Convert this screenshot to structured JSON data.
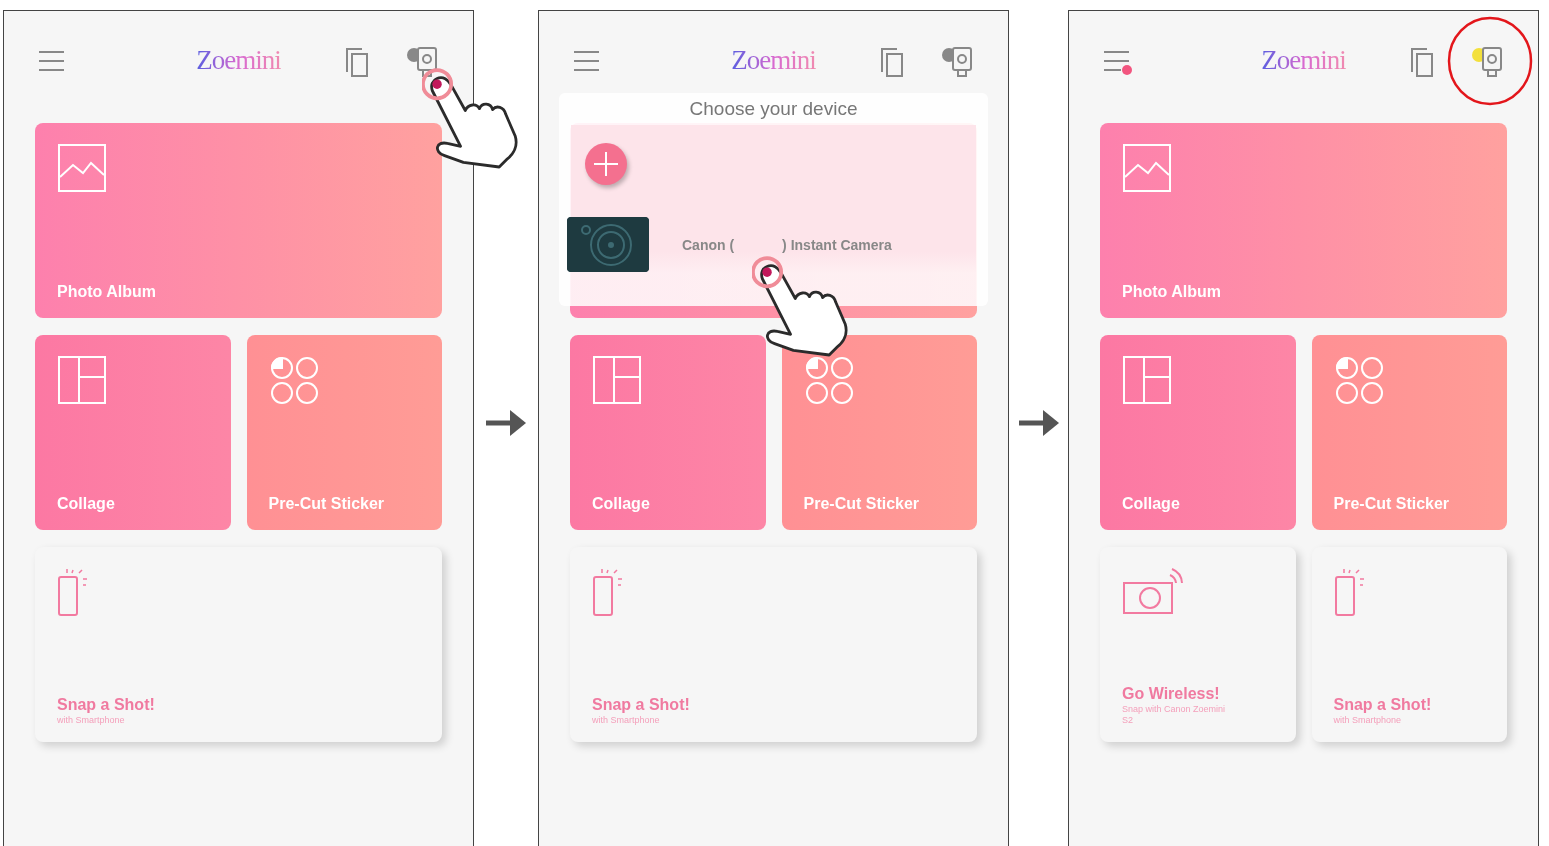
{
  "panels": [
    {
      "header": {
        "logo": "Zoemini",
        "menu_badge": false,
        "device_connected": false
      },
      "rows": [
        [
          {
            "kind": "photo",
            "title": "Photo Album"
          }
        ],
        [
          {
            "kind": "collage",
            "title": "Collage"
          },
          {
            "kind": "sticker",
            "title": "Pre-Cut Sticker"
          }
        ],
        [
          {
            "kind": "phone",
            "title": "Snap a Shot!",
            "subtitle": "with Smartphone"
          }
        ]
      ],
      "overlay": {
        "kind": "tap_device_icon"
      }
    },
    {
      "header": {
        "logo": "Zoemini",
        "menu_badge": false,
        "device_connected": false
      },
      "rows": [
        [
          {
            "kind": "photo"
          }
        ],
        [
          {
            "kind": "collage",
            "title": "Collage"
          },
          {
            "kind": "sticker",
            "title": "Pre-Cut Sticker"
          }
        ],
        [
          {
            "kind": "phone",
            "title": "Snap a Shot!",
            "subtitle": "with Smartphone"
          }
        ]
      ],
      "overlay": {
        "kind": "device_picker",
        "title": "Choose your device",
        "device_name_parts": [
          "Canon (",
          ") Instant Camera"
        ]
      }
    },
    {
      "header": {
        "logo": "Zoemini",
        "menu_badge": true,
        "device_connected": true
      },
      "rows": [
        [
          {
            "kind": "photo",
            "title": "Photo Album"
          }
        ],
        [
          {
            "kind": "collage",
            "title": "Collage"
          },
          {
            "kind": "sticker",
            "title": "Pre-Cut Sticker"
          }
        ],
        [
          {
            "kind": "camera",
            "title": "Go Wireless!",
            "subtitle": "Snap with Canon Zoemini S2"
          },
          {
            "kind": "phone",
            "title": "Snap a Shot!",
            "subtitle": "with Smartphone"
          }
        ]
      ],
      "overlay": {
        "kind": "highlight_device_icon"
      }
    }
  ]
}
